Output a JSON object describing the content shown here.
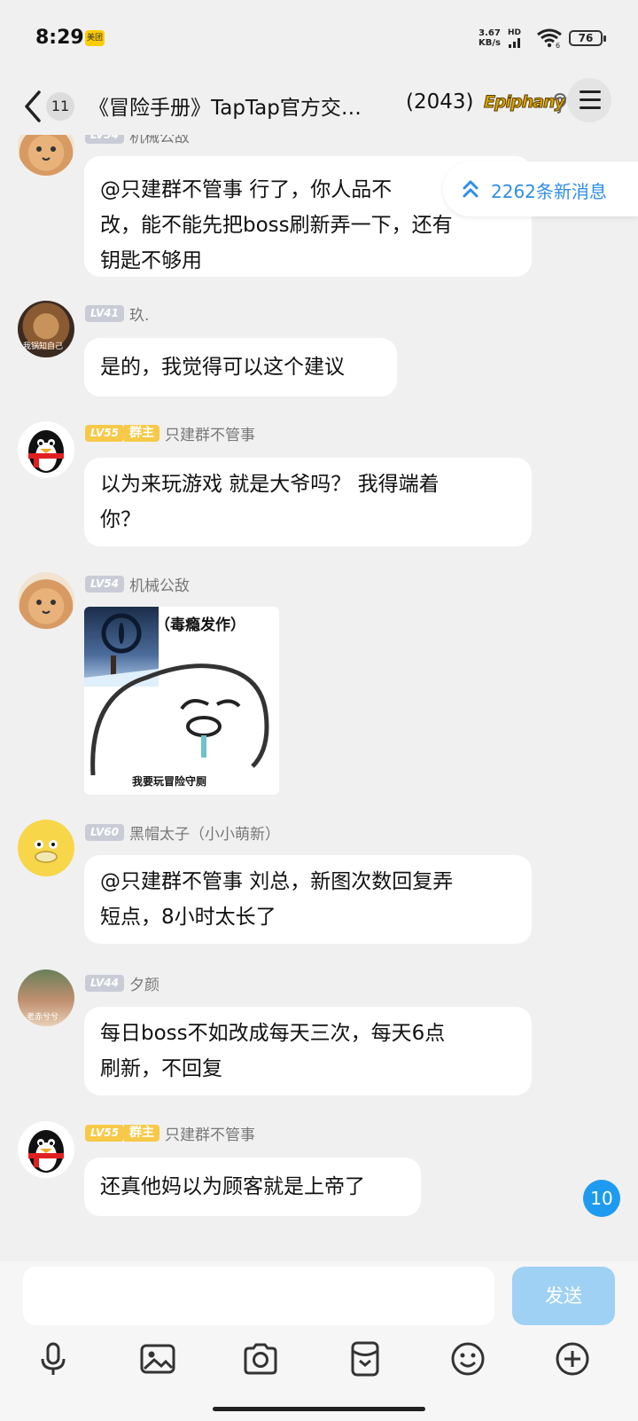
{
  "status_bar": {
    "time": "8:29",
    "app_badge": "美团",
    "net_speed_value": "3.67",
    "net_speed_unit": "KB/s",
    "network_type": "HD",
    "wifi_label": "6",
    "battery": "76"
  },
  "header": {
    "unread_count": "11",
    "title": "《冒险手册》TapTap官方交…",
    "member_count": "(2043)",
    "logo_text": "Epiphany"
  },
  "new_messages_banner": "2262条新消息",
  "messages": [
    {
      "level": "",
      "role": "",
      "nickname": "机械公敌",
      "text_lines": [
        "@只建群不管事 行了，你人品不",
        "改，能不能先把boss刷新弄一下，还有",
        "钥匙不够用"
      ]
    },
    {
      "level": "LV41",
      "role": "",
      "nickname": "玖.",
      "avatar_caption": "我锅知自己",
      "text_lines": [
        "是的，我觉得可以这个建议"
      ]
    },
    {
      "level": "LV55",
      "role": "群主",
      "nickname": "只建群不管事",
      "text_lines": [
        "以为来玩游戏 就是大爷吗？ 我得端着",
        "你？"
      ]
    },
    {
      "level": "LV54",
      "role": "",
      "nickname": "机械公敌",
      "sticker_top_text": "（毒瘾发作）",
      "sticker_bottom_text": "我要玩冒险守厕"
    },
    {
      "level": "LV60",
      "role": "",
      "nickname": "黑帽太子（小小萌新）",
      "text_lines": [
        "@只建群不管事 刘总，新图次数回复弄",
        "短点，8小时太长了"
      ]
    },
    {
      "level": "LV44",
      "role": "",
      "nickname": "夕颜",
      "avatar_caption": "老赤兮兮",
      "text_lines": [
        "每日boss不如改成每天三次，每天6点",
        "刷新，不回复"
      ]
    },
    {
      "level": "LV55",
      "role": "群主",
      "nickname": "只建群不管事",
      "text_lines": [
        "还真他妈以为顾客就是上帝了"
      ]
    }
  ],
  "bottom_unread": "10",
  "input": {
    "send_label": "发送"
  },
  "toolbar": [
    "mic-icon",
    "image-icon",
    "camera-icon",
    "red-packet-icon",
    "emoji-icon",
    "plus-icon"
  ]
}
